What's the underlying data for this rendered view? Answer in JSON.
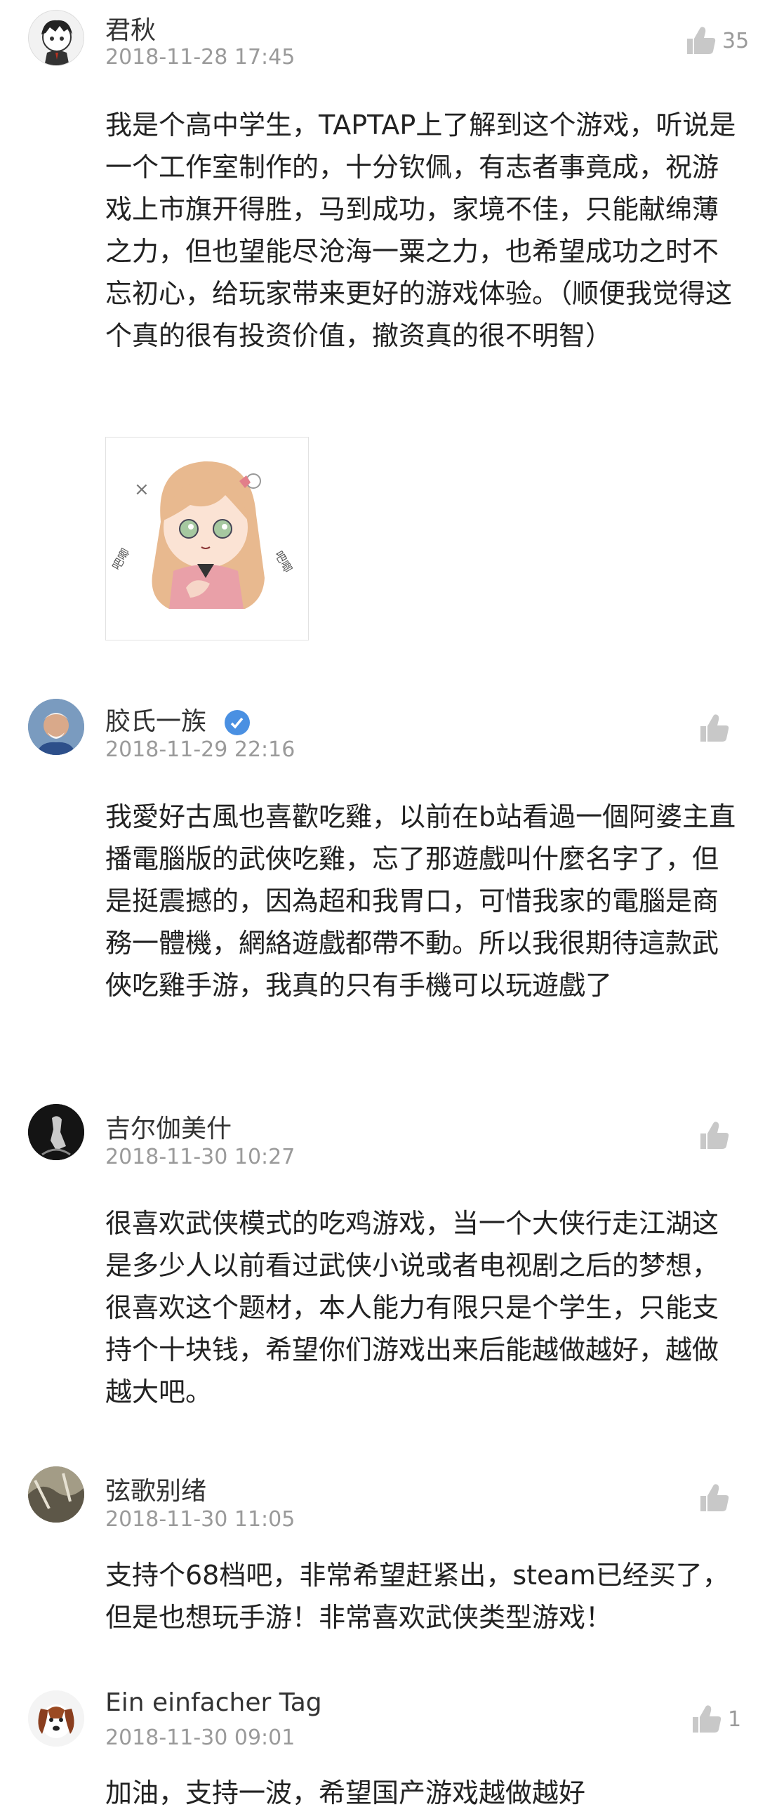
{
  "comments": [
    {
      "user": "君秋",
      "time": "2018-11-28 17:45",
      "likes": "35",
      "text": "我是个高中学生，TAPTAP上了解到这个游戏，听说是一个工作室制作的，十分钦佩，有志者事竟成，祝游戏上市旗开得胜，马到成功，家境不佳，只能献绵薄之力，但也望能尽沧海一粟之力，也希望成功之时不忘初心，给玩家带来更好的游戏体验。（顺便我觉得这个真的很有投资价值，撤资真的很不明智）",
      "sticker_text_left": "吧唧",
      "sticker_text_right": "吧唧"
    },
    {
      "user": "胶氏一族",
      "time": "2018-11-29 22:16",
      "likes": "",
      "text": "我愛好古風也喜歡吃雞，以前在b站看過一個阿婆主直播電腦版的武俠吃雞，忘了那遊戲叫什麼名字了，但是挺震撼的，因為超和我胃口，可惜我家的電腦是商務一體機，網絡遊戲都帶不動。所以我很期待這款武俠吃雞手游，我真的只有手機可以玩遊戲了"
    },
    {
      "user": "吉尔伽美什",
      "time": "2018-11-30 10:27",
      "likes": "",
      "text": "很喜欢武侠模式的吃鸡游戏，当一个大侠行走江湖这是多少人以前看过武侠小说或者电视剧之后的梦想，很喜欢这个题材，本人能力有限只是个学生，只能支持个十块钱，希望你们游戏出来后能越做越好，越做越大吧。"
    },
    {
      "user": "弦歌别绪",
      "time": "2018-11-30 11:05",
      "likes": "",
      "text": "支持个68档吧，非常希望赶紧出，steam已经买了，但是也想玩手游！非常喜欢武侠类型游戏！"
    },
    {
      "user": "Ein einfacher Tag",
      "time": "2018-11-30 09:01",
      "likes": "1",
      "text": "加油，支持一波，希望国产游戏越做越好"
    }
  ],
  "colors": {
    "muted": "#9a9a9a",
    "text": "#222222",
    "name": "#333333",
    "badge": "#4a90e2"
  }
}
